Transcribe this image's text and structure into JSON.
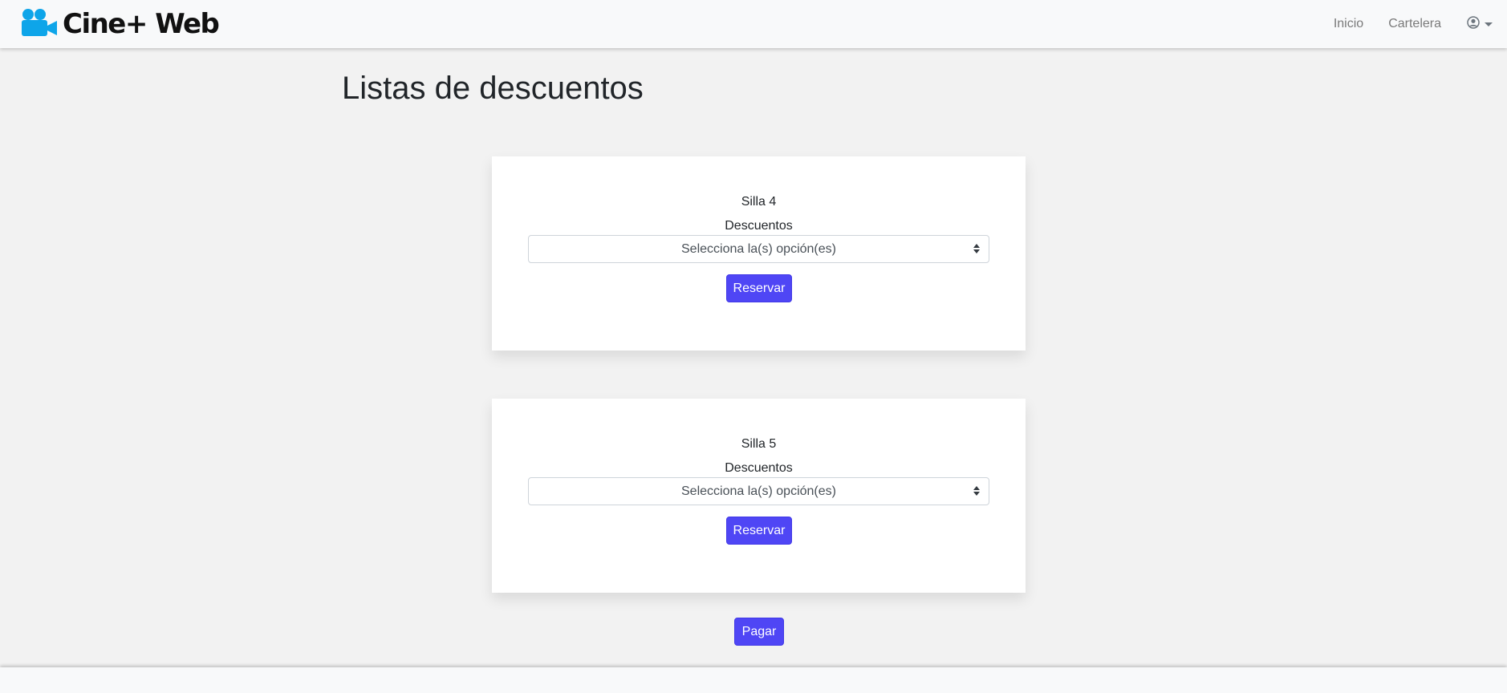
{
  "navbar": {
    "brand": "Cine+ Web",
    "brand_icon": "video-camera-icon",
    "links": [
      {
        "label": "Inicio"
      },
      {
        "label": "Cartelera"
      }
    ],
    "user_icon": "user-circle-icon"
  },
  "page": {
    "title": "Listas de descuentos"
  },
  "seats": [
    {
      "label": "Silla 4",
      "discounts_label": "Descuentos",
      "select_placeholder": "Selecciona la(s) opción(es)",
      "button_label": "Reservar"
    },
    {
      "label": "Silla 5",
      "discounts_label": "Descuentos",
      "select_placeholder": "Selecciona la(s) opción(es)",
      "button_label": "Reservar"
    }
  ],
  "pay_button": "Pagar",
  "colors": {
    "accent": "#4f46f5",
    "brand_icon": "#0ea5e9",
    "background": "#f2f2f2"
  }
}
